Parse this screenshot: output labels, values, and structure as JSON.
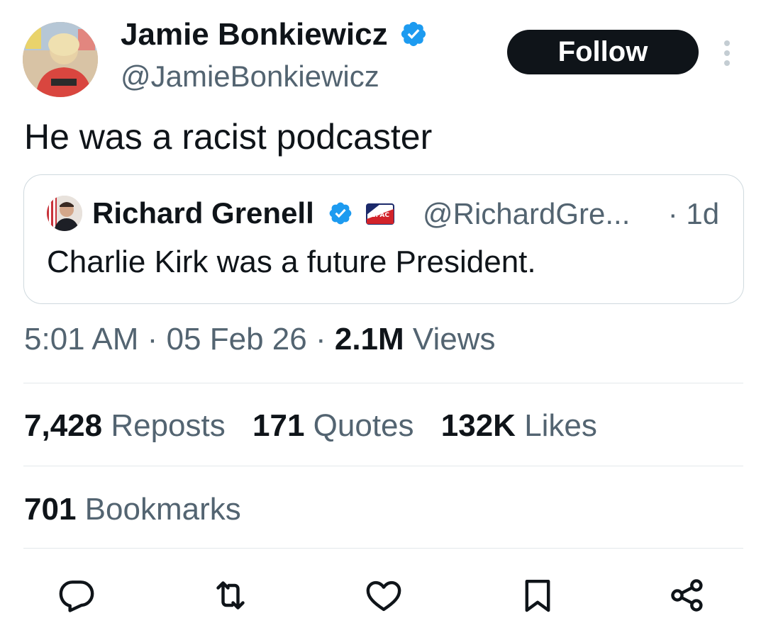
{
  "author": {
    "name": "Jamie Bonkiewicz",
    "handle": "@JamieBonkiewicz",
    "verified": true,
    "avatar": "profile-photo"
  },
  "follow_label": "Follow",
  "more_icon": "more-vertical-icon",
  "tweet_text": "He was a racist podcaster",
  "quoted": {
    "name": "Richard Grenell",
    "verified": true,
    "affiliate_badge": "CPAC",
    "handle": "@RichardGre...",
    "age": "· 1d",
    "text": "Charlie Kirk was a future President."
  },
  "meta": {
    "time": "5:01 AM",
    "sep1": "·",
    "date": "05 Feb 26",
    "sep2": "·",
    "views_count": "2.1M",
    "views_label": "Views"
  },
  "stats": {
    "reposts_count": "7,428",
    "reposts_label": "Reposts",
    "quotes_count": "171",
    "quotes_label": "Quotes",
    "likes_count": "132K",
    "likes_label": "Likes"
  },
  "bookmarks": {
    "count": "701",
    "label": "Bookmarks"
  },
  "actions": [
    "reply-icon",
    "repost-icon",
    "like-icon",
    "bookmark-icon",
    "share-icon"
  ],
  "colors": {
    "text": "#0f1419",
    "secondary": "#536471",
    "verified": "#1d9bf0",
    "border": "#cfd9de"
  }
}
